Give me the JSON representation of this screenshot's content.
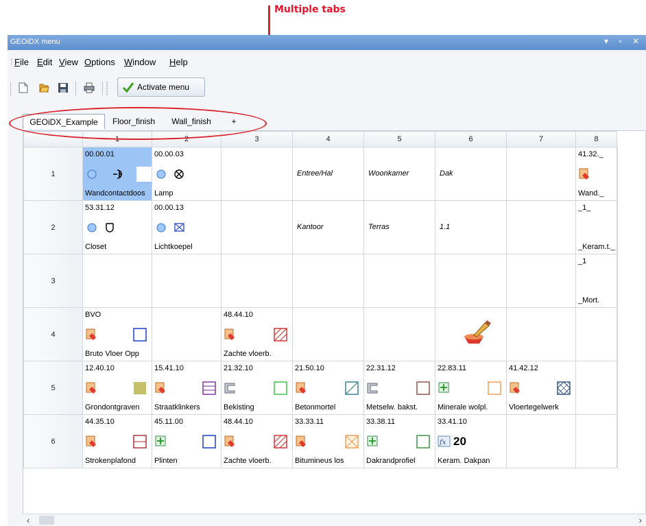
{
  "annotation": {
    "text": "Multiple tabs"
  },
  "window": {
    "title": "GEOiDX menu",
    "controls": "▾ ▫ ✕"
  },
  "menu": [
    {
      "label": "File",
      "u": "F",
      "rest": "ile"
    },
    {
      "label": "Edit",
      "u": "E",
      "rest": "dit"
    },
    {
      "label": "View",
      "u": "V",
      "rest": "iew"
    },
    {
      "label": "Options",
      "u": "O",
      "rest": "ptions"
    },
    {
      "label": "Window",
      "u": "W",
      "rest": "indow"
    },
    {
      "label": "Help",
      "u": "H",
      "rest": "elp"
    }
  ],
  "toolbar": {
    "activate_label": "Activate menu"
  },
  "tabs": [
    "GEOiDX_Example",
    "Floor_finish",
    "Wall_finish",
    "+"
  ],
  "grid": {
    "columns": [
      "1",
      "2",
      "3",
      "4",
      "5",
      "6",
      "7",
      "8"
    ],
    "rows": [
      "1",
      "2",
      "3",
      "4",
      "5",
      "6"
    ],
    "cells": {
      "r1c1": {
        "code": "00.00.01",
        "name": "Wandcontactdoos"
      },
      "r1c2": {
        "code": "00.00.03",
        "name": "Lamp"
      },
      "r1c4": {
        "text": "Entree/Hal"
      },
      "r1c5": {
        "text": "Woonkamer"
      },
      "r1c6": {
        "text": "Dak"
      },
      "r1c8": {
        "code": "41.32._",
        "name": "Wand._"
      },
      "r2c1": {
        "code": "53.31.12",
        "name": "Closet"
      },
      "r2c2": {
        "code": "00.00.13",
        "name": "Lichtkoepel"
      },
      "r2c4": {
        "text": "Kantoor"
      },
      "r2c5": {
        "text": "Terras"
      },
      "r2c6": {
        "text": "1.1"
      },
      "r2c8": {
        "code": "_1_",
        "name": "_Keram.t._"
      },
      "r3c8": {
        "code": "_1",
        "name": "_Mort."
      },
      "r4c1": {
        "code": "BVO",
        "name": "Bruto Vloer Opp"
      },
      "r4c3": {
        "code": "48.44.10",
        "name": "Zachte vloerb."
      },
      "r5c1": {
        "code": "12.40.10",
        "name": "Grondontgraven"
      },
      "r5c2": {
        "code": "15.41.10",
        "name": "Straatklinkers"
      },
      "r5c3": {
        "code": "21.32.10",
        "name": "Bekisting"
      },
      "r5c4": {
        "code": "21.50.10",
        "name": "Betonmortel"
      },
      "r5c5": {
        "code": "22.31.12",
        "name": "Metselw. bakst."
      },
      "r5c6": {
        "code": "22.83.11",
        "name": "Minerale wolpl."
      },
      "r5c7": {
        "code": "41.42.12",
        "name": "Vloertegelwerk"
      },
      "r6c1": {
        "code": "44.35.10",
        "name": "Strokenplafond"
      },
      "r6c2": {
        "code": "45.11.00",
        "name": "Plinten"
      },
      "r6c3": {
        "code": "48.44.10",
        "name": "Zachte vloerb."
      },
      "r6c4": {
        "code": "33.33.11",
        "name": "Bitumineus los"
      },
      "r6c5": {
        "code": "33.38.11",
        "name": "Dakrandprofiel"
      },
      "r6c6": {
        "code": "33.41.10",
        "name": "Keram. Dakpan",
        "value": "20"
      }
    }
  },
  "colors": {
    "selection": "#9cc4f5",
    "annotation": "#e8142c",
    "title_bar": "#6b9ad6"
  }
}
